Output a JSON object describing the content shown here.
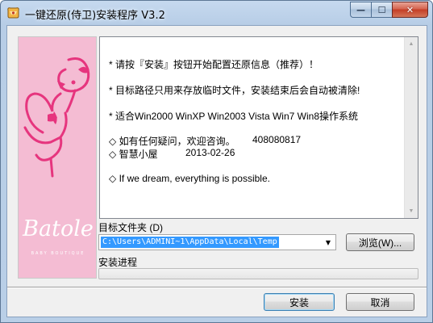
{
  "window": {
    "title": "一键还原(侍卫)安装程序 V3.2",
    "close_glyph": "✕",
    "minimize_glyph": "—",
    "maximize_glyph": "☐"
  },
  "banner": {
    "brand": "Batole",
    "brand_sub": "BABY BOUTIQUE"
  },
  "info": {
    "line1": "*  请按『安装』按钮开始配置还原信息（推荐）！",
    "line2": "*  目标路径只用来存放临时文件，安装结束后会自动被清除!",
    "line3": "*  适合Win2000 WinXP Win2003 Vista Win7 Win8操作系统",
    "contact_label": "◇    如有任何疑问，欢迎咨询。",
    "contact_value": "408080817",
    "author_label": "◇    智慧小屋",
    "author_date": "2013-02-26",
    "motto": "◇    If we dream, everything is possible."
  },
  "target": {
    "label": "目标文件夹 (D)",
    "path": "C:\\Users\\ADMINI~1\\AppData\\Local\\Temp",
    "browse_label": "浏览(W)..."
  },
  "progress": {
    "label": "安装进程",
    "value": 0
  },
  "buttons": {
    "install": "安装",
    "cancel": "取消"
  },
  "colors": {
    "banner_bg": "#f4bcd3",
    "flamingo": "#e6357e",
    "titlebar": "#c6d9ef",
    "close_button": "#c43e26",
    "selection": "#3399ff"
  },
  "icons": {
    "app": "installer-icon",
    "dropdown": "chevron-down-icon",
    "banner": "flamingo-logo"
  }
}
